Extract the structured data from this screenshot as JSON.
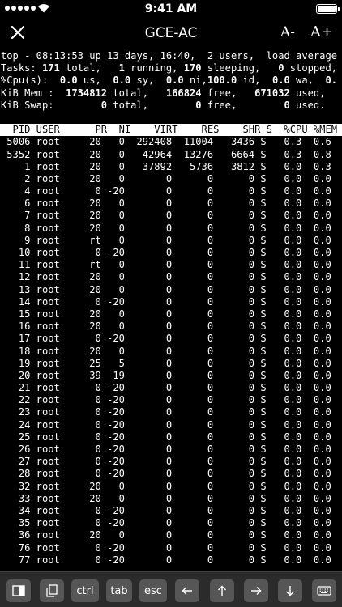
{
  "status_bar": {
    "time": "9:41 AM"
  },
  "nav": {
    "title": "GCE-AC",
    "font_decrease": "A-",
    "font_increase": "A+"
  },
  "summary": {
    "line1": "top - 08:13:53 up 13 days, 16:40,  2 users,  load average",
    "tasks": {
      "prefix": "Tasks: ",
      "total": "171",
      "total_label": " total,   ",
      "running": "1",
      "running_label": " running, ",
      "sleeping": "170",
      "sleeping_label": " sleeping,   ",
      "stopped": "0",
      "stopped_label": " stopped,"
    },
    "cpu": {
      "prefix": "%Cpu(s):  ",
      "us": "0.0",
      "us_label": " us,  ",
      "sy": "0.0",
      "sy_label": " sy,  ",
      "ni": "0.0",
      "ni_label": " ni,",
      "id": "100.0",
      "id_label": " id,  ",
      "wa": "0.0",
      "wa_label": " wa,  ",
      "last": "0."
    },
    "mem": {
      "prefix": "KiB Mem :  ",
      "total": "1734812",
      "total_label": " total,   ",
      "free": "166824",
      "free_label": " free,   ",
      "used": "671032",
      "used_label": " used,"
    },
    "swap": {
      "prefix": "KiB Swap:        ",
      "total": "0",
      "total_label": " total,        ",
      "free": "0",
      "free_label": " free,        ",
      "used": "0",
      "used_label": " used."
    }
  },
  "process_table": {
    "header": "  PID USER      PR  NI    VIRT    RES    SHR S  %CPU %MEM",
    "rows": [
      [
        "5006",
        "root",
        "20",
        "0",
        "292408",
        "11004",
        "3436",
        "S",
        "0.3",
        "0.6"
      ],
      [
        "5352",
        "root",
        "20",
        "0",
        "42964",
        "13276",
        "6664",
        "S",
        "0.3",
        "0.8"
      ],
      [
        "1",
        "root",
        "20",
        "0",
        "37892",
        "5736",
        "3812",
        "S",
        "0.0",
        "0.3"
      ],
      [
        "2",
        "root",
        "20",
        "0",
        "0",
        "0",
        "0",
        "S",
        "0.0",
        "0.0"
      ],
      [
        "4",
        "root",
        "0",
        "-20",
        "0",
        "0",
        "0",
        "S",
        "0.0",
        "0.0"
      ],
      [
        "6",
        "root",
        "20",
        "0",
        "0",
        "0",
        "0",
        "S",
        "0.0",
        "0.0"
      ],
      [
        "7",
        "root",
        "20",
        "0",
        "0",
        "0",
        "0",
        "S",
        "0.0",
        "0.0"
      ],
      [
        "8",
        "root",
        "20",
        "0",
        "0",
        "0",
        "0",
        "S",
        "0.0",
        "0.0"
      ],
      [
        "9",
        "root",
        "rt",
        "0",
        "0",
        "0",
        "0",
        "S",
        "0.0",
        "0.0"
      ],
      [
        "10",
        "root",
        "0",
        "-20",
        "0",
        "0",
        "0",
        "S",
        "0.0",
        "0.0"
      ],
      [
        "11",
        "root",
        "rt",
        "0",
        "0",
        "0",
        "0",
        "S",
        "0.0",
        "0.0"
      ],
      [
        "12",
        "root",
        "20",
        "0",
        "0",
        "0",
        "0",
        "S",
        "0.0",
        "0.0"
      ],
      [
        "13",
        "root",
        "20",
        "0",
        "0",
        "0",
        "0",
        "S",
        "0.0",
        "0.0"
      ],
      [
        "14",
        "root",
        "0",
        "-20",
        "0",
        "0",
        "0",
        "S",
        "0.0",
        "0.0"
      ],
      [
        "15",
        "root",
        "20",
        "0",
        "0",
        "0",
        "0",
        "S",
        "0.0",
        "0.0"
      ],
      [
        "16",
        "root",
        "20",
        "0",
        "0",
        "0",
        "0",
        "S",
        "0.0",
        "0.0"
      ],
      [
        "17",
        "root",
        "0",
        "-20",
        "0",
        "0",
        "0",
        "S",
        "0.0",
        "0.0"
      ],
      [
        "18",
        "root",
        "20",
        "0",
        "0",
        "0",
        "0",
        "S",
        "0.0",
        "0.0"
      ],
      [
        "19",
        "root",
        "25",
        "5",
        "0",
        "0",
        "0",
        "S",
        "0.0",
        "0.0"
      ],
      [
        "20",
        "root",
        "39",
        "19",
        "0",
        "0",
        "0",
        "S",
        "0.0",
        "0.0"
      ],
      [
        "21",
        "root",
        "0",
        "-20",
        "0",
        "0",
        "0",
        "S",
        "0.0",
        "0.0"
      ],
      [
        "22",
        "root",
        "0",
        "-20",
        "0",
        "0",
        "0",
        "S",
        "0.0",
        "0.0"
      ],
      [
        "23",
        "root",
        "0",
        "-20",
        "0",
        "0",
        "0",
        "S",
        "0.0",
        "0.0"
      ],
      [
        "24",
        "root",
        "0",
        "-20",
        "0",
        "0",
        "0",
        "S",
        "0.0",
        "0.0"
      ],
      [
        "25",
        "root",
        "0",
        "-20",
        "0",
        "0",
        "0",
        "S",
        "0.0",
        "0.0"
      ],
      [
        "26",
        "root",
        "0",
        "-20",
        "0",
        "0",
        "0",
        "S",
        "0.0",
        "0.0"
      ],
      [
        "27",
        "root",
        "0",
        "-20",
        "0",
        "0",
        "0",
        "S",
        "0.0",
        "0.0"
      ],
      [
        "28",
        "root",
        "0",
        "-20",
        "0",
        "0",
        "0",
        "S",
        "0.0",
        "0.0"
      ],
      [
        "32",
        "root",
        "20",
        "0",
        "0",
        "0",
        "0",
        "S",
        "0.0",
        "0.0"
      ],
      [
        "33",
        "root",
        "20",
        "0",
        "0",
        "0",
        "0",
        "S",
        "0.0",
        "0.0"
      ],
      [
        "34",
        "root",
        "0",
        "-20",
        "0",
        "0",
        "0",
        "S",
        "0.0",
        "0.0"
      ],
      [
        "35",
        "root",
        "0",
        "-20",
        "0",
        "0",
        "0",
        "S",
        "0.0",
        "0.0"
      ],
      [
        "36",
        "root",
        "20",
        "0",
        "0",
        "0",
        "0",
        "S",
        "0.0",
        "0.0"
      ],
      [
        "76",
        "root",
        "0",
        "-20",
        "0",
        "0",
        "0",
        "S",
        "0.0",
        "0.0"
      ],
      [
        "77",
        "root",
        "0",
        "-20",
        "0",
        "0",
        "0",
        "S",
        "0.0",
        "0.0"
      ]
    ]
  },
  "toolbar": {
    "icons": [
      "split-view-icon",
      "clipboard-icon",
      "arrow-left-icon",
      "arrow-up-icon",
      "arrow-right-icon",
      "arrow-down-icon",
      "keyboard-icon"
    ],
    "ctrl_label": "ctrl",
    "tab_label": "tab",
    "esc_label": "esc"
  }
}
